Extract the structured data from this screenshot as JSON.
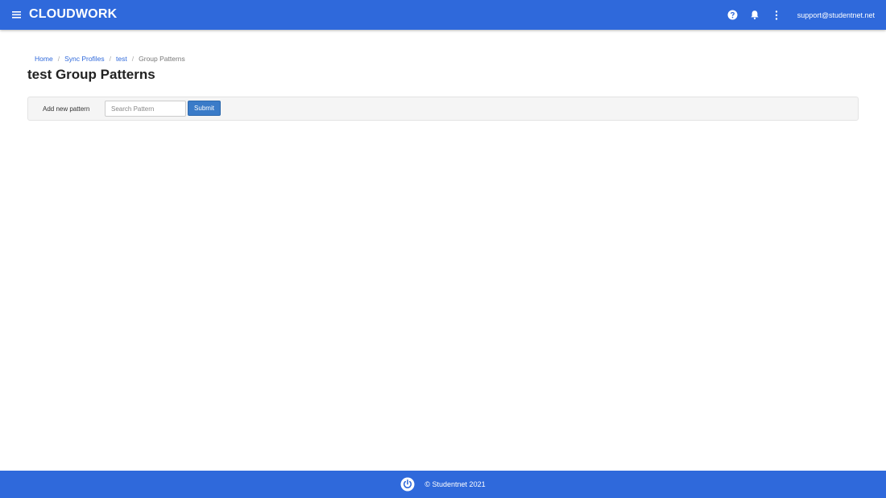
{
  "header": {
    "brand": "CLOUDWORK",
    "user_email": "support@studentnet.net",
    "icons": [
      "menu-icon",
      "help-icon",
      "bell-icon",
      "more-vertical-icon"
    ]
  },
  "breadcrumb": {
    "items": [
      "Home",
      "Sync Profiles",
      "test"
    ],
    "current": "Group Patterns",
    "separator": "/"
  },
  "page": {
    "title": "test Group Patterns"
  },
  "form": {
    "label": "Add new pattern",
    "input_placeholder": "Search Pattern",
    "input_value": "",
    "submit_label": "Submit"
  },
  "footer": {
    "text": "© Studentnet 2021",
    "icon": "power-icon"
  },
  "colors": {
    "primary": "#2f69db",
    "button": "#3a7bc8",
    "link": "#2f69db"
  }
}
